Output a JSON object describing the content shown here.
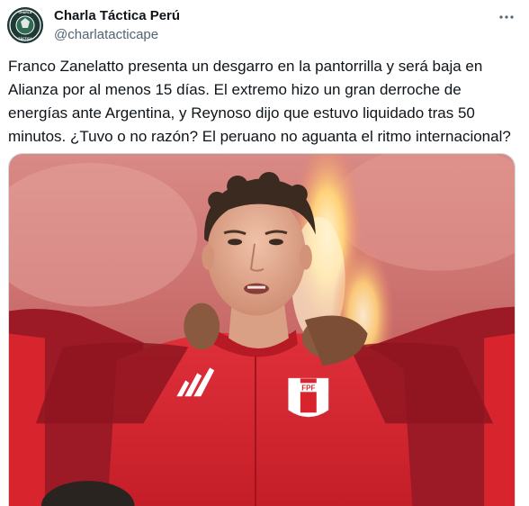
{
  "author": {
    "display_name": "Charla Táctica Perú",
    "handle": "@charlatacticape",
    "avatar_icon": "charla-tactica-logo-icon"
  },
  "menu": {
    "more_icon": "more-horizontal-icon"
  },
  "tweet": {
    "text": "Franco Zanelatto presenta un desgarro en la pantorrilla y será baja en\nAlianza por al menos 15 días. El extremo hizo un gran derroche de\nenergías ante Argentina, y Reynoso dijo que estuvo liquidado tras 50\nminutos. ¿Tuvo o no razón? El peruano no aguanta el ritmo internacional?"
  },
  "media": {
    "badge_text": "FPF"
  },
  "colors": {
    "text_primary": "#0f1419",
    "text_secondary": "#536471",
    "border": "#cfd9de",
    "jersey_red": "#d8242c"
  }
}
